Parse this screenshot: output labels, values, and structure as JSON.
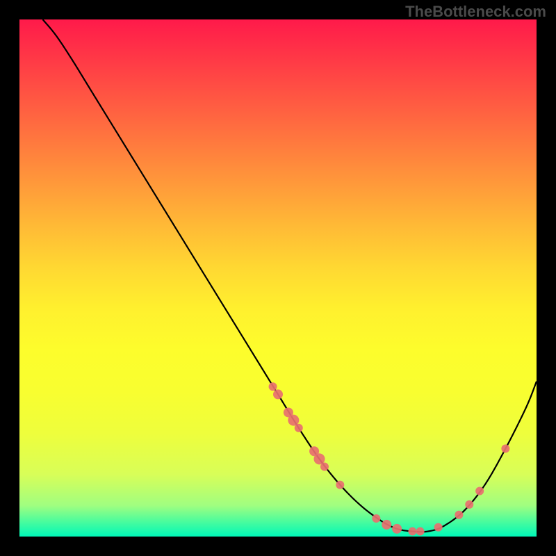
{
  "watermark": "TheBottleneck.com",
  "chart_data": {
    "type": "line",
    "title": "",
    "xlabel": "",
    "ylabel": "",
    "xlim": [
      0,
      100
    ],
    "ylim": [
      0,
      100
    ],
    "grid": false,
    "series": [
      {
        "name": "bottleneck-curve",
        "color": "#000000",
        "x": [
          4.5,
          7,
          10,
          14,
          18,
          22,
          26,
          30,
          34,
          38,
          42,
          46,
          50,
          54,
          58,
          62,
          66,
          70,
          73,
          76,
          79,
          82,
          86,
          90,
          94,
          98,
          100
        ],
        "y": [
          100,
          97,
          92.5,
          86,
          79.5,
          73,
          66.5,
          60,
          53.5,
          47,
          40.5,
          34,
          27.5,
          21,
          15,
          10,
          6,
          3,
          1.5,
          1,
          1,
          2,
          5,
          10,
          17,
          25,
          30
        ]
      }
    ],
    "scatter_points_on_curve": {
      "name": "highlighted-points",
      "color": "#e8706f",
      "radius_small": 6,
      "radius_large": 8,
      "points": [
        {
          "x": 49,
          "y": 29,
          "r": 6
        },
        {
          "x": 50,
          "y": 27.5,
          "r": 7
        },
        {
          "x": 52,
          "y": 24,
          "r": 7
        },
        {
          "x": 53,
          "y": 22.5,
          "r": 8
        },
        {
          "x": 54,
          "y": 21,
          "r": 6
        },
        {
          "x": 57,
          "y": 16.5,
          "r": 7
        },
        {
          "x": 58,
          "y": 15,
          "r": 8
        },
        {
          "x": 59,
          "y": 13.5,
          "r": 6
        },
        {
          "x": 62,
          "y": 10,
          "r": 6
        },
        {
          "x": 69,
          "y": 3.5,
          "r": 6
        },
        {
          "x": 71,
          "y": 2.3,
          "r": 7
        },
        {
          "x": 73,
          "y": 1.5,
          "r": 7
        },
        {
          "x": 76,
          "y": 1,
          "r": 6
        },
        {
          "x": 77.5,
          "y": 1,
          "r": 6
        },
        {
          "x": 81,
          "y": 1.8,
          "r": 6
        },
        {
          "x": 85,
          "y": 4.2,
          "r": 6
        },
        {
          "x": 87,
          "y": 6.2,
          "r": 6
        },
        {
          "x": 89,
          "y": 8.8,
          "r": 6
        },
        {
          "x": 94,
          "y": 17,
          "r": 6
        }
      ]
    },
    "gradient": {
      "direction": "vertical",
      "stops": [
        {
          "pos": 0,
          "color": "#ff1a4a"
        },
        {
          "pos": 0.5,
          "color": "#fff02e"
        },
        {
          "pos": 1,
          "color": "#00f8b8"
        }
      ]
    }
  }
}
